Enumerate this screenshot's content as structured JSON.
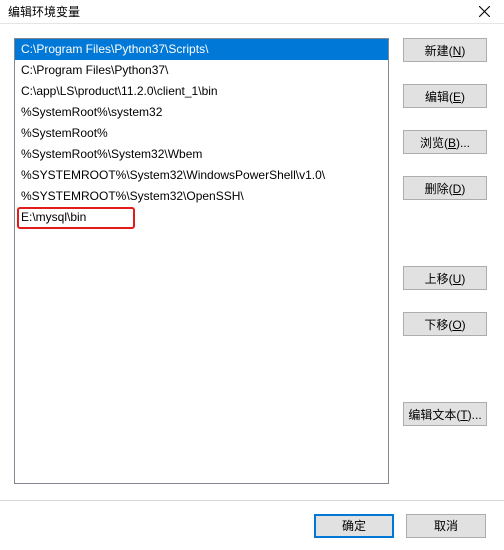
{
  "window": {
    "title": "编辑环境变量"
  },
  "list": {
    "items": [
      "C:\\Program Files\\Python37\\Scripts\\",
      "C:\\Program Files\\Python37\\",
      "C:\\app\\LS\\product\\11.2.0\\client_1\\bin",
      "%SystemRoot%\\system32",
      "%SystemRoot%",
      "%SystemRoot%\\System32\\Wbem",
      "%SYSTEMROOT%\\System32\\WindowsPowerShell\\v1.0\\",
      "%SYSTEMROOT%\\System32\\OpenSSH\\",
      "E:\\mysql\\bin"
    ],
    "selected": 0
  },
  "buttons": {
    "new": {
      "label": "新建(",
      "accel": "N",
      "suffix": ")"
    },
    "edit": {
      "label": "编辑(",
      "accel": "E",
      "suffix": ")"
    },
    "browse": {
      "label": "浏览(",
      "accel": "B",
      "suffix": ")..."
    },
    "delete": {
      "label": "删除(",
      "accel": "D",
      "suffix": ")"
    },
    "moveup": {
      "label": "上移(",
      "accel": "U",
      "suffix": ")"
    },
    "movedown": {
      "label": "下移(",
      "accel": "O",
      "suffix": ")"
    },
    "edittext": {
      "label": "编辑文本(",
      "accel": "T",
      "suffix": ")..."
    }
  },
  "footer": {
    "ok": "确定",
    "cancel": "取消"
  }
}
